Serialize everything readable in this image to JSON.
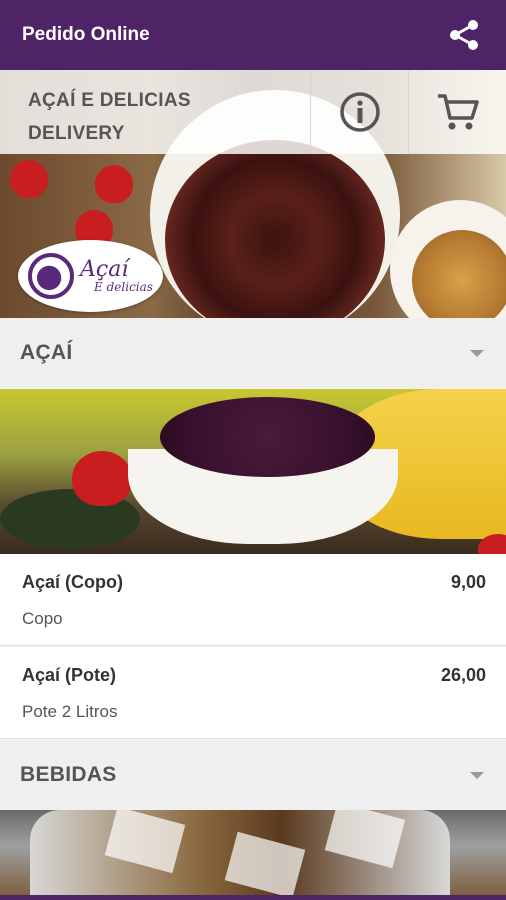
{
  "appbar": {
    "title": "Pedido Online",
    "share_icon": "share-icon"
  },
  "store": {
    "name_line1": "AÇAÍ E DELICIAS",
    "name_line2": "DELIVERY",
    "info_icon": "info-icon",
    "cart_icon": "cart-icon"
  },
  "logo": {
    "line1": "Açaí",
    "line2": "E delicias"
  },
  "colors": {
    "brand": "#4e2466",
    "section_bg": "#efefef",
    "text": "#333333"
  },
  "sections": [
    {
      "name": "AÇAÍ",
      "items": [
        {
          "name": "Açaí (Copo)",
          "price": "9,00",
          "desc": "Copo"
        },
        {
          "name": "Açaí (Pote)",
          "price": "26,00",
          "desc": "Pote 2 Litros"
        }
      ]
    },
    {
      "name": "BEBIDAS",
      "items": []
    }
  ]
}
